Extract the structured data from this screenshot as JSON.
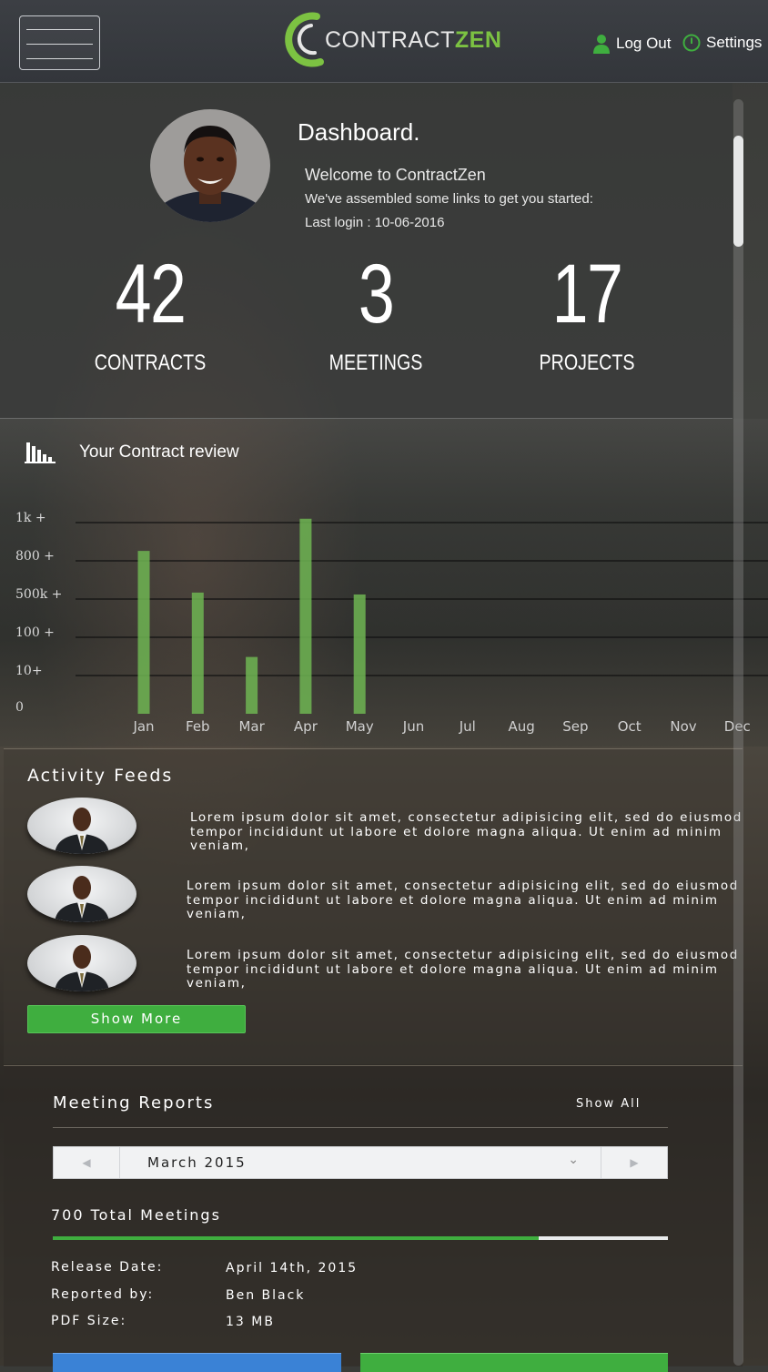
{
  "header": {
    "logo_text_1": "CONTRACT",
    "logo_text_2": "ZEN",
    "logout_label": "Log Out",
    "settings_label": "Settings",
    "accent_color": "#7cc242"
  },
  "dashboard": {
    "title": "Dashboard.",
    "welcome": "Welcome to ContractZen",
    "subtitle": "We've assembled some links to get you started:",
    "last_login": "Last login : 10-06-2016",
    "stats": [
      {
        "value": "42",
        "label": "CONTRACTS"
      },
      {
        "value": "3",
        "label": "MEETINGS"
      },
      {
        "value": "17",
        "label": "PROJECTS"
      }
    ]
  },
  "chart_data": {
    "type": "bar",
    "title": "Your Contract review",
    "y_tick_labels": [
      "1k +",
      "800 +",
      "500k +",
      "100 +",
      "10+",
      "0"
    ],
    "categories": [
      "Jan",
      "Feb",
      "Mar",
      "Apr",
      "May",
      "Jun",
      "Jul",
      "Aug",
      "Sep",
      "Oct",
      "Nov",
      "Dec"
    ],
    "values": [
      860,
      640,
      300,
      1030,
      630,
      null,
      null,
      null,
      null,
      null,
      null,
      null
    ],
    "ylim": [
      0,
      1000
    ],
    "grid": true,
    "bar_color": "#6fb552"
  },
  "activity": {
    "title": "Activity Feeds",
    "items": [
      {
        "text": "Lorem ipsum dolor sit amet, consectetur adipisicing elit, sed do eiusmod tempor incididunt ut labore et dolore magna aliqua. Ut enim ad minim veniam,"
      },
      {
        "text": "Lorem ipsum dolor sit amet, consectetur adipisicing elit, sed do eiusmod tempor incididunt ut labore et dolore magna aliqua. Ut enim ad minim veniam,"
      },
      {
        "text": "Lorem ipsum dolor sit amet, consectetur adipisicing elit, sed do eiusmod tempor incididunt ut labore et dolore magna aliqua. Ut enim ad minim veniam,"
      }
    ],
    "show_more_label": "Show More"
  },
  "meetings": {
    "title": "Meeting Reports",
    "show_all_label": "Show All",
    "month": "March 2015",
    "total": "700 Total Meetings",
    "progress": 0.79,
    "release_date_label": "Release Date:",
    "release_date": "April 14th, 2015",
    "reported_by_label": "Reported by:",
    "reported_by": "Ben Black",
    "pdf_size_label": "PDF Size:",
    "pdf_size": "13 MB",
    "chat_color": "#3a82d6",
    "download_color": "#3fae3f"
  }
}
